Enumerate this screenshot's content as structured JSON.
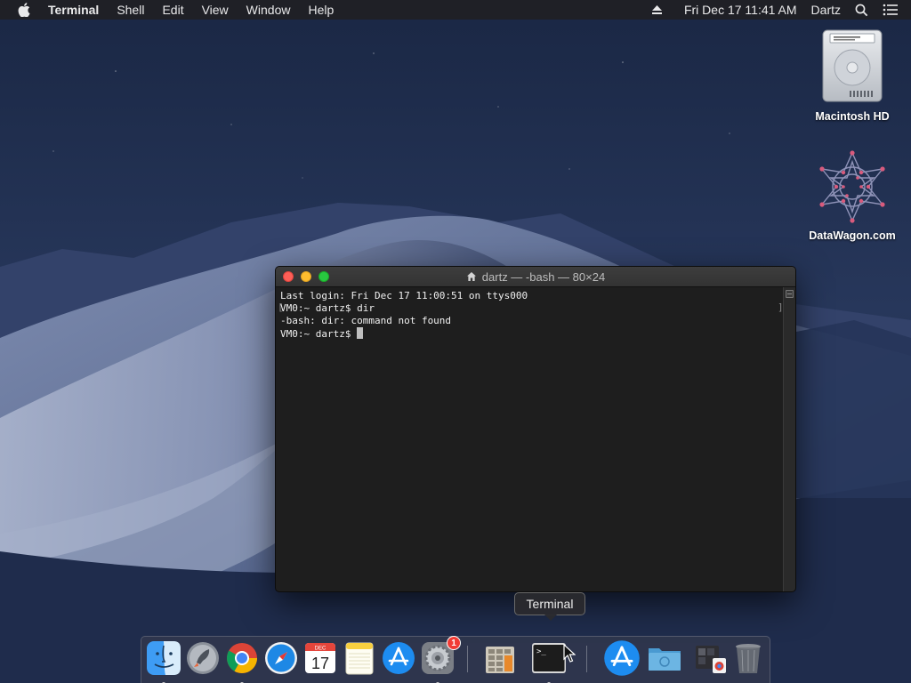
{
  "menubar": {
    "app_name": "Terminal",
    "menus": [
      "Shell",
      "Edit",
      "View",
      "Window",
      "Help"
    ],
    "datetime": "Fri Dec 17  11:41 AM",
    "user": "Dartz"
  },
  "desktop": {
    "icons": [
      {
        "label": "Macintosh HD",
        "icon": "hard-drive-icon"
      },
      {
        "label": "DataWagon.com",
        "icon": "datawagon-logo-icon"
      }
    ]
  },
  "terminal": {
    "title": "dartz — -bash — 80×24",
    "lines": [
      "Last login: Fri Dec 17 11:00:51 on ttys000",
      "VM0:~ dartz$ dir",
      "-bash: dir: command not found",
      "VM0:~ dartz$ "
    ]
  },
  "tooltip": {
    "text": "Terminal"
  },
  "dock": {
    "items": [
      {
        "name": "Finder",
        "icon": "finder-icon",
        "running": true
      },
      {
        "name": "Launchpad",
        "icon": "launchpad-icon",
        "running": false
      },
      {
        "name": "Google Chrome",
        "icon": "chrome-icon",
        "running": true
      },
      {
        "name": "Safari",
        "icon": "safari-icon",
        "running": false
      },
      {
        "name": "Calendar",
        "icon": "calendar-icon",
        "running": false,
        "month": "DEC",
        "day": "17"
      },
      {
        "name": "Notes",
        "icon": "notes-icon",
        "running": false
      },
      {
        "name": "App Store",
        "icon": "app-store-icon",
        "running": false
      },
      {
        "name": "System Preferences",
        "icon": "system-preferences-icon",
        "running": true,
        "badge": "1"
      },
      {
        "name": "Unknown App",
        "icon": "grid-app-icon",
        "running": false
      },
      {
        "name": "Terminal",
        "icon": "terminal-icon",
        "running": true
      },
      {
        "name": "App Store Downloads",
        "icon": "app-store-icon",
        "running": false
      },
      {
        "name": "Folder",
        "icon": "folder-icon",
        "running": false
      },
      {
        "name": "Recent Items",
        "icon": "stack-icon",
        "running": false
      },
      {
        "name": "Trash",
        "icon": "trash-icon",
        "running": false
      }
    ]
  },
  "colors": {
    "close": "#fe5f57",
    "minimize": "#febc2e",
    "maximize": "#28c840",
    "badge": "#f13b35"
  }
}
